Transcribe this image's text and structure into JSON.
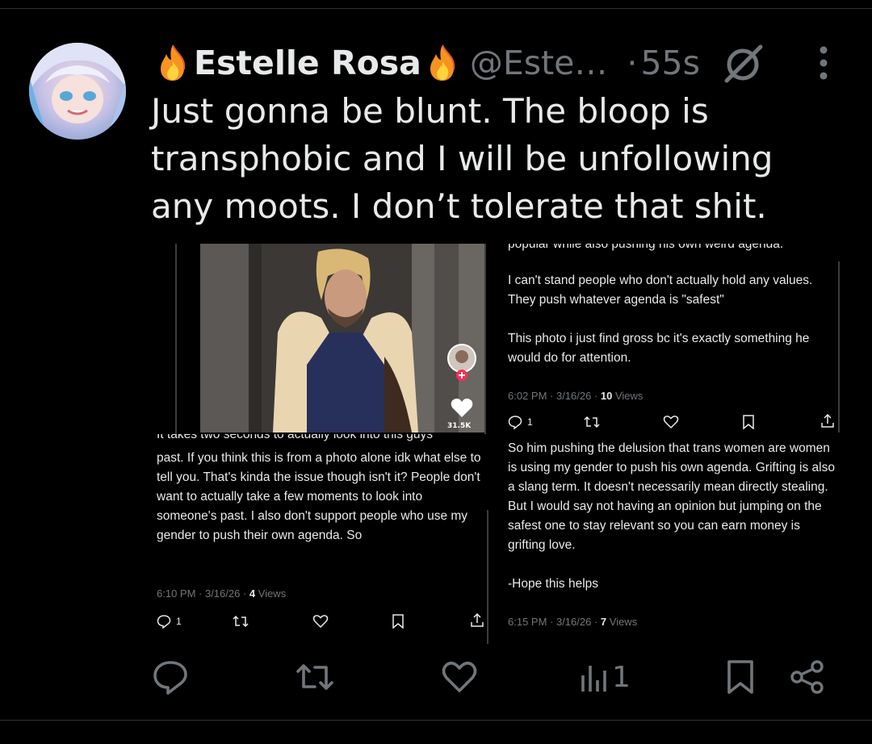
{
  "tweet": {
    "display_name": "Estelle Rosa",
    "handle": "@Este…",
    "separator": "·",
    "time": "55s",
    "text": "Just gonna be blunt. The bloop is transphobic and I will be unfollowing any moots. I don’t tolerate that shit.",
    "views_count": "1"
  },
  "embedded": {
    "video_like_count": "31.5K",
    "right_cut_line": "popular while also pushing his own weird agenda.",
    "right_post_1": {
      "paragraph_1": "I can't stand people who don't actually hold any values. They push whatever agenda is \"safest\"",
      "paragraph_2": "This photo i just find gross bc it's exactly something he would do for attention.",
      "meta_prefix": "6:02 PM · 3/16/26 · ",
      "views_num": "10",
      "views_label": " Views",
      "reply_count": "1"
    },
    "right_post_2": {
      "paragraph_1": "So him pushing the delusion that trans women are women is using my gender to push his own agenda. Grifting is also a slang term. It doesn't necessarily mean directly stealing. But I would say not having an opinion but jumping on the safest one to stay relevant so you can earn money is grifting love.",
      "paragraph_2": "-Hope this helps",
      "meta_prefix": "6:15 PM · 3/16/26 · ",
      "views_num": "7",
      "views_label": " Views"
    },
    "left_cut_line": "It takes two seconds to actually look into this guys",
    "left_post": {
      "paragraph_1": "past. If you think this is from a photo alone idk what else to tell you. That's kinda the issue though isn't it? People don't want to actually take a few moments to look into someone's past. I also don't support people who use my gender to push their own agenda. So",
      "meta_prefix": "6:10 PM · 3/16/26 · ",
      "views_num": "4",
      "views_label": " Views",
      "reply_count": "1"
    }
  },
  "icons": [
    "fire-emoji",
    "mute-icon",
    "more-icon",
    "reply-icon",
    "retweet-icon",
    "like-icon",
    "views-icon",
    "bookmark-icon",
    "share-icon"
  ],
  "colors": {
    "background": "#000000",
    "text": "#e7e9ea",
    "muted": "#71767b",
    "divider": "#2f3336",
    "video_badge": "#fe2c55"
  }
}
